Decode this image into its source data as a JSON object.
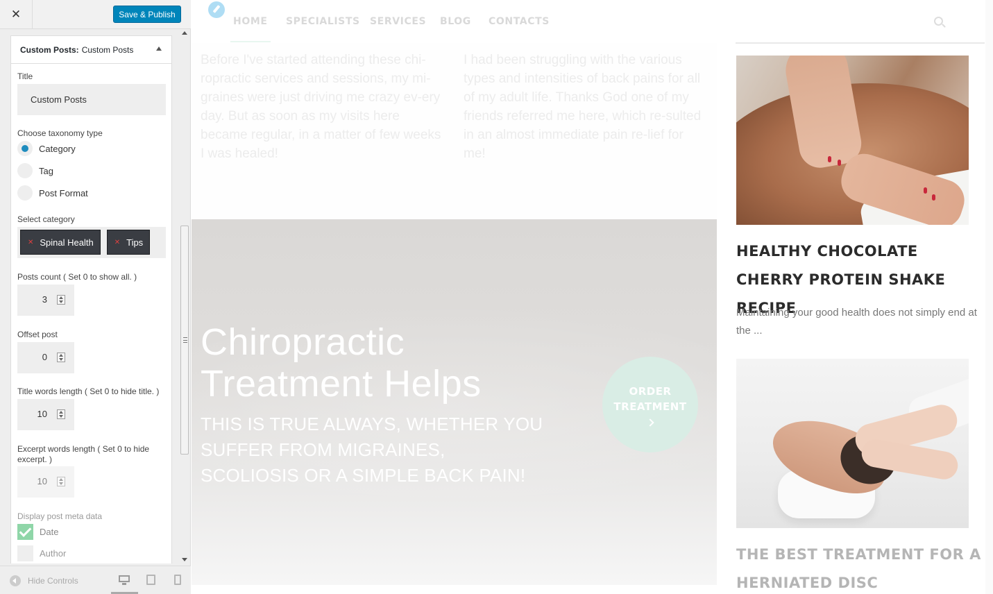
{
  "customizer": {
    "save_label": "Save & Publish",
    "section": {
      "prefix": "Custom Posts:",
      "name": "Custom Posts"
    },
    "title": {
      "label": "Title",
      "value": "Custom Posts"
    },
    "taxonomy": {
      "label": "Choose taxonomy type",
      "options": [
        "Category",
        "Tag",
        "Post Format"
      ],
      "selected": "Category"
    },
    "category": {
      "label": "Select category",
      "tags": [
        "Spinal Health",
        "Tips"
      ]
    },
    "posts_count": {
      "label": "Posts count ( Set 0 to show all. )",
      "value": "3"
    },
    "offset": {
      "label": "Offset post",
      "value": "0"
    },
    "title_words": {
      "label": "Title words length ( Set 0 to hide title. )",
      "value": "10"
    },
    "excerpt_words": {
      "label": "Excerpt words length ( Set 0 to hide excerpt. )",
      "value": "10"
    },
    "meta": {
      "label": "Display post meta data",
      "items": [
        {
          "label": "Date",
          "checked": true
        },
        {
          "label": "Author",
          "checked": false
        }
      ]
    },
    "footer": {
      "hide_label": "Hide Controls"
    }
  },
  "site": {
    "nav": [
      "HOME",
      "SPECIALISTS",
      "SERVICES",
      "BLOG",
      "CONTACTS"
    ],
    "testimonials": [
      "Before I've started attending these chi-ropractic services and sessions, my mi-graines were just driving me crazy ev-ery day. But as soon as my visits here became regular, in a matter of few weeks I was healed!",
      "I had been struggling with the various types and intensities of back pains for all of my adult life. Thanks God one of my friends referred me here, which re-sulted in an almost immediate pain re-lief for me!"
    ],
    "hero": {
      "title": "Chiropractic Treatment Helps",
      "subtitle": "THIS IS TRUE ALWAYS, WHETHER YOU SUFFER FROM MIGRAINES, SCOLIOSIS OR A SIMPLE BACK PAIN!",
      "cta_line1": "ORDER",
      "cta_line2": "TREATMENT"
    },
    "posts": [
      {
        "title": "HEALTHY CHOCOLATE CHERRY PROTEIN SHAKE RECIPE",
        "excerpt": "Maintaining your good health does not simply end at the ..."
      },
      {
        "title": "THE BEST TREATMENT FOR A HERNIATED DISC"
      }
    ]
  }
}
